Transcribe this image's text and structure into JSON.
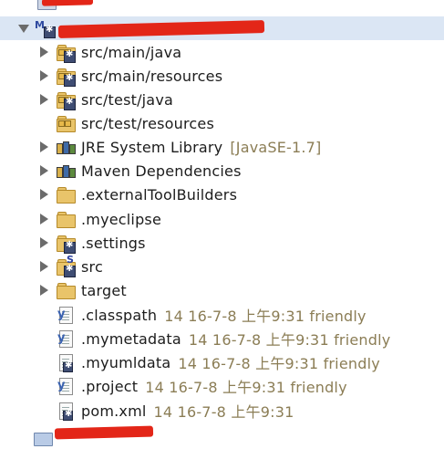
{
  "tree": {
    "items": [
      {
        "label": "src/main/java",
        "meta": ""
      },
      {
        "label": "src/main/resources",
        "meta": ""
      },
      {
        "label": "src/test/java",
        "meta": ""
      },
      {
        "label": "src/test/resources",
        "meta": ""
      },
      {
        "label": "JRE System Library",
        "meta": "[JavaSE-1.7]"
      },
      {
        "label": "Maven Dependencies",
        "meta": ""
      },
      {
        "label": ".externalToolBuilders",
        "meta": ""
      },
      {
        "label": ".myeclipse",
        "meta": ""
      },
      {
        "label": ".settings",
        "meta": ""
      },
      {
        "label": "src",
        "meta": ""
      },
      {
        "label": "target",
        "meta": ""
      },
      {
        "label": ".classpath",
        "meta": "14  16-7-8 上午9:31  friendly"
      },
      {
        "label": ".mymetadata",
        "meta": "14  16-7-8 上午9:31  friendly"
      },
      {
        "label": ".myumldata",
        "meta": "14  16-7-8 上午9:31  friendly"
      },
      {
        "label": ".project",
        "meta": "14  16-7-8 上午9:31  friendly"
      },
      {
        "label": "pom.xml",
        "meta": "14  16-7-8 上午9:31"
      }
    ]
  },
  "icons": {
    "package_folder": "package-folder-icon",
    "library": "library-icon",
    "folder": "folder-icon",
    "file": "file-icon",
    "project": "maven-project-icon"
  },
  "colors": {
    "selection": "#dbe6f4",
    "meta_text": "#8b7d55",
    "redaction": "#e32618"
  }
}
